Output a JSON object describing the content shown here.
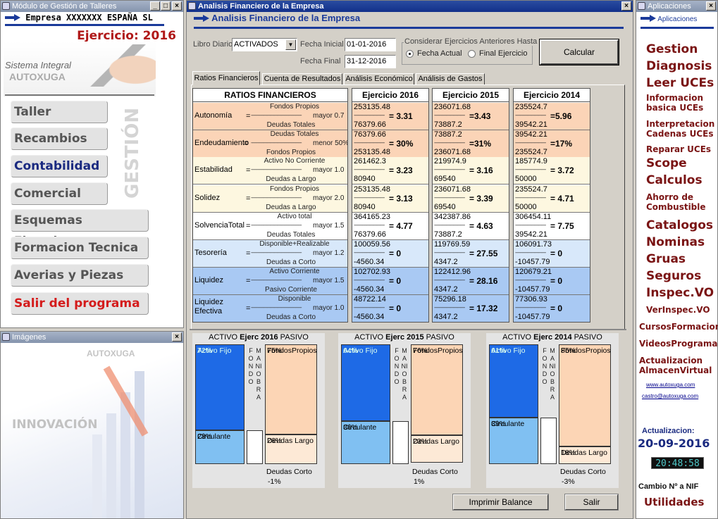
{
  "left_window": {
    "title": "Módulo de Gestión de Talleres",
    "company": "Empresa XXXXXXX ESPAÑA SL",
    "exercise": "Ejercicio: 2016",
    "logo_line1": "Sistema Integral",
    "logo_line2": "AUTOXUGA",
    "gestion_vertical": "GESTIÓN",
    "menu": [
      "Taller",
      "Recambios",
      "Contabilidad",
      "Comercial",
      "Esquemas Electricos",
      "Formacion Tecnica",
      "Averias y Piezas",
      "Salir del programa"
    ]
  },
  "images_window": {
    "title": "Imágenes",
    "brand": "AUTOXUGA",
    "caption": "INNOVACIÓN"
  },
  "main_window": {
    "title": "Analisis Financiero de la Empresa",
    "header": "Analisis Financiero de la Empresa",
    "libro_label": "Libro Diario",
    "libro_value": "ACTIVADOS",
    "fecha_ini_label": "Fecha Inicial",
    "fecha_ini": "01-01-2016",
    "fecha_fin_label": "Fecha Final",
    "fecha_fin": "31-12-2016",
    "consider_label": "Considerar Ejercicios Anteriores Hasta",
    "radio1": "Fecha Actual",
    "radio2": "Final Ejercicio",
    "calc": "Calcular",
    "tabs": [
      "Ratios Financieros",
      "Cuenta de Resultados",
      "Análisis Económico",
      "Análisis de Gastos"
    ],
    "ratio_header": "RATIOS FINANCIEROS",
    "year_headers": [
      "Ejercicio 2016",
      "Ejercicio 2015",
      "Ejercicio 2014"
    ],
    "ratios": [
      {
        "name": "Autonomía",
        "num": "Fondos Propios",
        "den": "Deudas Totales",
        "cond": "mayor 0.7",
        "vals": [
          [
            "253135.48",
            "76379.66",
            "= 3.31"
          ],
          [
            "236071.68",
            "73887.2",
            "=3.43"
          ],
          [
            "235524.7",
            "39542.21",
            "=5.96"
          ]
        ]
      },
      {
        "name": "Endeudamiento",
        "num": "Deudas Totales",
        "den": "Fondos Propios",
        "cond": "menor 50%",
        "vals": [
          [
            "76379.66",
            "253135.48",
            "= 30%"
          ],
          [
            "73887.2",
            "236071.68",
            "=31%"
          ],
          [
            "39542.21",
            "235524.7",
            "=17%"
          ]
        ]
      },
      {
        "name": "Estabilidad",
        "num": "Activo No Corriente",
        "den": "Deudas a Largo",
        "cond": "mayor 1.0",
        "vals": [
          [
            "261462.3",
            "80940",
            "= 3.23"
          ],
          [
            "219974.9",
            "69540",
            "= 3.16"
          ],
          [
            "185774.9",
            "50000",
            "= 3.72"
          ]
        ]
      },
      {
        "name": "Solidez",
        "num": "Fondos Propios",
        "den": "Deudas a Largo",
        "cond": "mayor 2.0",
        "vals": [
          [
            "253135.48",
            "80940",
            "= 3.13"
          ],
          [
            "236071.68",
            "69540",
            "= 3.39"
          ],
          [
            "235524.7",
            "50000",
            "= 4.71"
          ]
        ]
      },
      {
        "name": "SolvenciaTotal",
        "num": "Activo total",
        "den": "Deudas Totales",
        "cond": "mayor 1.5",
        "vals": [
          [
            "364165.23",
            "76379.66",
            "= 4.77"
          ],
          [
            "342387.86",
            "73887.2",
            "= 4.63"
          ],
          [
            "306454.11",
            "39542.21",
            "= 7.75"
          ]
        ]
      },
      {
        "name": "Tesorería",
        "num": "Disponible+Realizable",
        "den": "Deudas a Corto",
        "cond": "mayor 1.2",
        "vals": [
          [
            "100059.56",
            "-4560.34",
            "= 0"
          ],
          [
            "119769.59",
            "4347.2",
            "= 27.55"
          ],
          [
            "106091.73",
            "-10457.79",
            "= 0"
          ]
        ]
      },
      {
        "name": "Liquidez",
        "num": "Activo Corriente",
        "den": "Pasivo Corriente",
        "cond": "mayor 1.5",
        "vals": [
          [
            "102702.93",
            "-4560.34",
            "= 0"
          ],
          [
            "122412.96",
            "4347.2",
            "= 28.16"
          ],
          [
            "120679.21",
            "-10457.79",
            "= 0"
          ]
        ]
      },
      {
        "name": "Liquidez Efectiva",
        "num": "Disponible",
        "den": "Deudas a Corto",
        "cond": "mayor 1.0",
        "vals": [
          [
            "48722.14",
            "-4560.34",
            "= 0"
          ],
          [
            "75296.18",
            "4347.2",
            "= 17.32"
          ],
          [
            "77306.93",
            "-10457.79",
            "= 0"
          ]
        ]
      }
    ],
    "balances": [
      {
        "activo": "ACTIVO",
        "ejerc": "Ejerc 2016",
        "pasivo": "PASIVO",
        "af_label": "Activo Fijo",
        "af": "72%",
        "circ_label": "Circulante",
        "circ": "28%",
        "fp_label": "FondosPropios",
        "fp": "75%",
        "dl_label": "Deudas Largo",
        "dl": "26%",
        "dc_label": "Deudas Corto",
        "dc": "-1%"
      },
      {
        "activo": "ACTIVO",
        "ejerc": "Ejerc 2015",
        "pasivo": "PASIVO",
        "af_label": "Activo Fijo",
        "af": "64%",
        "circ_label": "Circulante",
        "circ": "36%",
        "fp_label": "FondosPropios",
        "fp": "76%",
        "dl_label": "Deudas Largo",
        "dl": "23%",
        "dc_label": "Deudas Corto",
        "dc": "1%"
      },
      {
        "activo": "ACTIVO",
        "ejerc": "Ejerc 2014",
        "pasivo": "PASIVO",
        "af_label": "Activo Fijo",
        "af": "61%",
        "circ_label": "Circulante",
        "circ": "39%",
        "fp_label": "FondosPropios",
        "fp": "85%",
        "dl_label": "Deudas Largo",
        "dl": "18%",
        "dc_label": "Deudas Corto",
        "dc": "-3%"
      }
    ],
    "fondo": "FONDO",
    "maniobra": "MANIOBRA",
    "print": "Imprimir Balance",
    "exit": "Salir"
  },
  "apps_window": {
    "title": "Aplicaciones",
    "header": "Aplicaciones",
    "items": [
      "Gestion",
      "Diagnosis",
      "Leer UCEs",
      "Informacion basica UCEs",
      "Interpretacion Cadenas UCEs",
      "Reparar UCEs",
      "Scope",
      "Calculos",
      "Ahorro de Combustible",
      "Catalogos",
      "Nominas",
      "Gruas",
      "Seguros",
      "Inspec.VO",
      "VerInspec.VO",
      "CursosFormacion",
      "VideosPrograma",
      "Actualizacion AlmacenVirtual"
    ],
    "link1": "www.autoxuga.com",
    "link2": "castro@autoxuga.com",
    "update_label": "Actualizacion:",
    "update_date": "20-09-2016",
    "clock": "20:48:58",
    "cambio": "Cambio Nº a NIF",
    "utilidades": "Utilidades"
  }
}
